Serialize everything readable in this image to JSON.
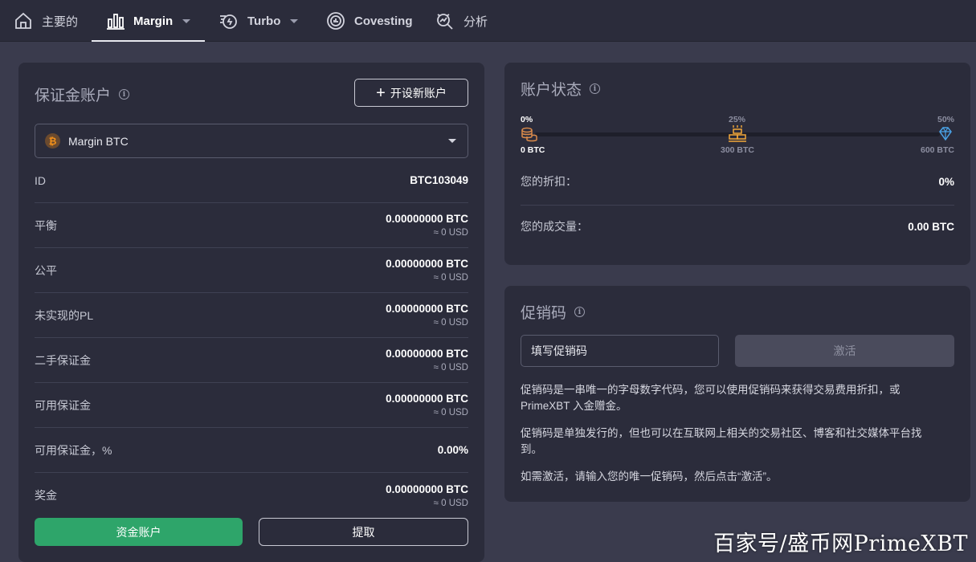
{
  "nav": {
    "items": [
      {
        "label": "主要的",
        "icon": "home-icon"
      },
      {
        "label": "Margin",
        "icon": "bar-chart-icon",
        "dropdown": true,
        "active": true
      },
      {
        "label": "Turbo",
        "icon": "turbo-icon",
        "dropdown": true
      },
      {
        "label": "Covesting",
        "icon": "covesting-icon"
      },
      {
        "label": "分析",
        "icon": "analysis-icon"
      }
    ]
  },
  "margin_account": {
    "title": "保证金账户",
    "open_button": "开设新账户",
    "selected_account": "Margin BTC",
    "coin_symbol": "₿",
    "rows": [
      {
        "label": "ID",
        "value": "BTC103049"
      },
      {
        "label": "平衡",
        "value": "0.00000000 BTC",
        "sub": "≈ 0 USD"
      },
      {
        "label": "公平",
        "value": "0.00000000 BTC",
        "sub": "≈ 0 USD"
      },
      {
        "label": "未实现的PL",
        "value": "0.00000000 BTC",
        "sub": "≈ 0 USD"
      },
      {
        "label": "二手保证金",
        "value": "0.00000000 BTC",
        "sub": "≈ 0 USD"
      },
      {
        "label": "可用保证金",
        "value": "0.00000000 BTC",
        "sub": "≈ 0 USD"
      },
      {
        "label": "可用保证金，%",
        "value": "0.00%"
      },
      {
        "label": "奖金",
        "value": "0.00000000 BTC",
        "sub": "≈ 0 USD"
      }
    ],
    "fund_button": "资金账户",
    "withdraw_button": "提取"
  },
  "account_status": {
    "title": "账户状态",
    "tiers": [
      {
        "pct": "0%",
        "amount": "0 BTC"
      },
      {
        "pct": "25%",
        "amount": "300 BTC"
      },
      {
        "pct": "50%",
        "amount": "600 BTC"
      }
    ],
    "progress_fraction": 0,
    "discount_label": "您的折扣：",
    "discount_value": "0%",
    "volume_label": "您的成交量：",
    "volume_value": "0.00 BTC"
  },
  "promo": {
    "title": "促销码",
    "input_placeholder": "填写促销码",
    "activate_button": "激活",
    "paragraphs": [
      "促销码是一串唯一的字母数字代码，您可以使用促销码来获得交易费用折扣，或 PrimeXBT 入金赠金。",
      "促销码是单独发行的，但也可以在互联网上相关的交易社区、博客和社交媒体平台找到。",
      "如需激活，请输入您的唯一促销码，然后点击“激活”。"
    ]
  },
  "watermark": "百家号/盛币网PrimeXBT",
  "colors": {
    "background": "#3a3b4d",
    "card": "#2b2c3b",
    "green": "#2ea56a",
    "bitcoin": "#f7931a",
    "diamond": "#4aa3e8"
  }
}
